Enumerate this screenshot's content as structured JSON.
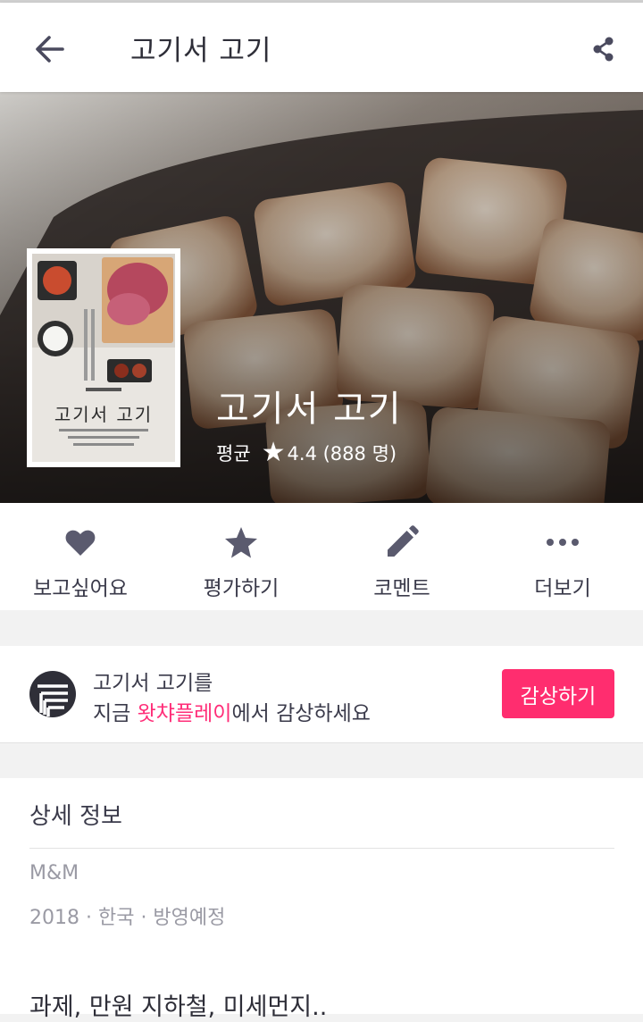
{
  "appbar": {
    "title": "고기서 고기"
  },
  "hero": {
    "title": "고기서 고기",
    "rating_label": "평균",
    "rating_value": "4.4 (888 명)",
    "poster_title": "고기서 고기"
  },
  "actions": [
    {
      "label": "보고싶어요",
      "icon": "heart-icon"
    },
    {
      "label": "평가하기",
      "icon": "star-icon"
    },
    {
      "label": "코멘트",
      "icon": "pencil-icon"
    },
    {
      "label": "더보기",
      "icon": "more-icon"
    }
  ],
  "promo": {
    "line1": "고기서 고기를",
    "line2_prefix": "지금 ",
    "brand": "왓챠플레이",
    "line2_suffix": "에서 감상하세요",
    "button": "감상하기"
  },
  "details": {
    "heading": "상세 정보",
    "producer": "M&M",
    "meta": "2018 · 한국 · 방영예정",
    "tagline": "과제, 만원 지하철, 미세먼지.."
  },
  "colors": {
    "accent": "#ff2d6f",
    "brand_text": "#ff2d78",
    "icon": "#5a5a6e"
  }
}
